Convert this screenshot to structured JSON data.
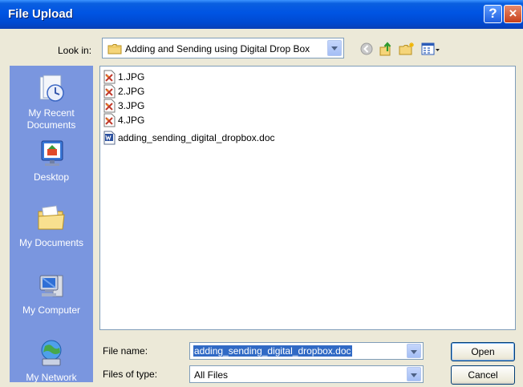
{
  "window": {
    "title": "File Upload",
    "help_label": "?",
    "close_label": "×"
  },
  "lookin": {
    "label": "Look in:",
    "value": "Adding and Sending using Digital Drop Box"
  },
  "places": [
    {
      "line1": "My Recent",
      "line2": "Documents"
    },
    {
      "line1": "Desktop",
      "line2": ""
    },
    {
      "line1": "My Documents",
      "line2": ""
    },
    {
      "line1": "My Computer",
      "line2": ""
    },
    {
      "line1": "My Network",
      "line2": ""
    }
  ],
  "files": [
    {
      "name": "1.JPG",
      "type": "image"
    },
    {
      "name": "2.JPG",
      "type": "image"
    },
    {
      "name": "3.JPG",
      "type": "image"
    },
    {
      "name": "4.JPG",
      "type": "image"
    },
    {
      "name": "adding_sending_digital_dropbox.doc",
      "type": "word"
    }
  ],
  "form": {
    "filename_label": "File name:",
    "filename_value": "adding_sending_digital_dropbox.doc",
    "filetype_label": "Files of type:",
    "filetype_value": "All Files"
  },
  "buttons": {
    "open": "Open",
    "cancel": "Cancel"
  },
  "colors": {
    "titlebar": "#0054e3",
    "places_bar": "#7a96df",
    "selection": "#316ac5",
    "window_bg": "#ece9d8"
  }
}
